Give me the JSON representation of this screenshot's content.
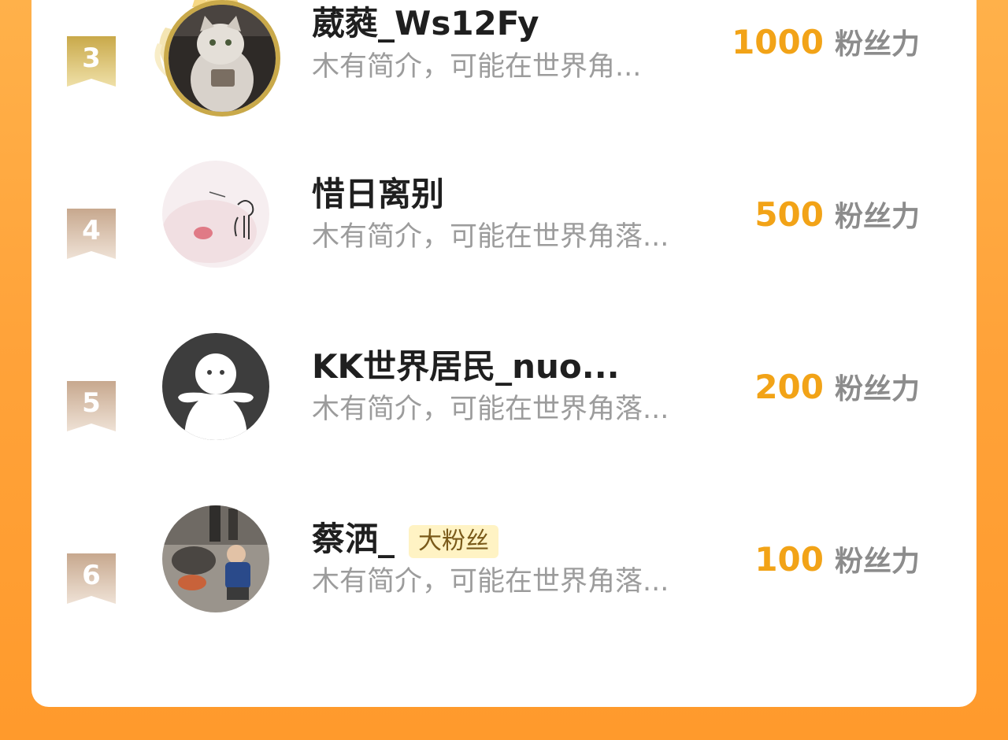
{
  "ranking": {
    "unit_label": "粉丝力",
    "entries": [
      {
        "rank": "3",
        "name": "葳蕤_Ws12Fy",
        "bio": "木有简介，可能在世界角...",
        "score": "1000",
        "badge": null,
        "avatar": "photo-cat",
        "crown": true
      },
      {
        "rank": "4",
        "name": "惜日离别",
        "bio": "木有简介，可能在世界角落...",
        "score": "500",
        "badge": null,
        "avatar": "photo-doodle",
        "crown": false
      },
      {
        "rank": "5",
        "name": "KK世界居民_nuo...",
        "bio": "木有简介，可能在世界角落...",
        "score": "200",
        "badge": null,
        "avatar": "default-avatar",
        "crown": false
      },
      {
        "rank": "6",
        "name": "蔡洒_",
        "bio": "木有简介，可能在世界角落...",
        "score": "100",
        "badge": "大粉丝",
        "avatar": "photo-person",
        "crown": false
      }
    ]
  },
  "colors": {
    "background": "#ffa33a",
    "score": "#f2a317",
    "gold_badge": "#d4b24c",
    "normal_badge": "#cdb199",
    "fan_tag_bg": "#fff3c4"
  }
}
